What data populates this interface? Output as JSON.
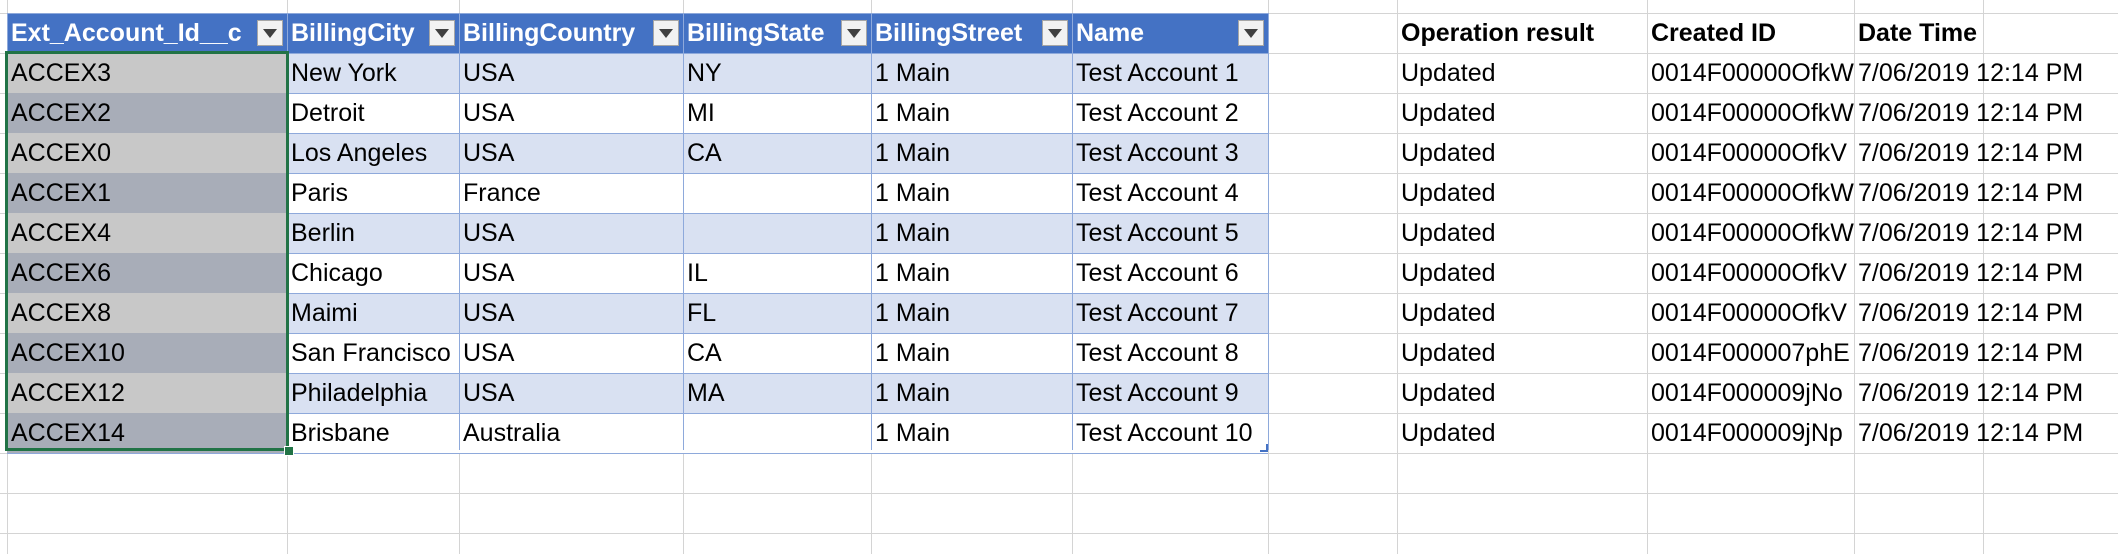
{
  "table": {
    "headers": [
      "Ext_Account_Id__c",
      "BillingCity",
      "BillingCountry",
      "BillingState",
      "BillingStreet",
      "Name"
    ],
    "rows": [
      [
        "ACCEX3",
        "New York",
        "USA",
        "NY",
        "1 Main",
        "Test Account 1"
      ],
      [
        "ACCEX2",
        "Detroit",
        "USA",
        "MI",
        "1 Main",
        "Test Account 2"
      ],
      [
        "ACCEX0",
        "Los Angeles",
        "USA",
        "CA",
        "1 Main",
        "Test Account 3"
      ],
      [
        "ACCEX1",
        "Paris",
        "France",
        "",
        "1 Main",
        "Test Account 4"
      ],
      [
        "ACCEX4",
        "Berlin",
        "USA",
        "",
        "1 Main",
        "Test Account 5"
      ],
      [
        "ACCEX6",
        "Chicago",
        "USA",
        "IL",
        "1 Main",
        "Test Account 6"
      ],
      [
        "ACCEX8",
        "Maimi",
        "USA",
        "FL",
        "1 Main",
        "Test Account 7"
      ],
      [
        "ACCEX10",
        "San Francisco",
        "USA",
        "CA",
        "1 Main",
        "Test Account 8"
      ],
      [
        "ACCEX12",
        "Philadelphia",
        "USA",
        "MA",
        "1 Main",
        "Test Account 9"
      ],
      [
        "ACCEX14",
        "Brisbane",
        "Australia",
        "",
        "1 Main",
        "Test Account 10"
      ]
    ]
  },
  "results": {
    "headers": [
      "Operation result",
      "Created ID",
      "Date Time"
    ],
    "rows": [
      [
        "Updated",
        "0014F00000OfkW",
        "7/06/2019 12:14 PM"
      ],
      [
        "Updated",
        "0014F00000OfkW",
        "7/06/2019 12:14 PM"
      ],
      [
        "Updated",
        "0014F00000OfkV",
        "7/06/2019 12:14 PM"
      ],
      [
        "Updated",
        "0014F00000OfkW",
        "7/06/2019 12:14 PM"
      ],
      [
        "Updated",
        "0014F00000OfkW",
        "7/06/2019 12:14 PM"
      ],
      [
        "Updated",
        "0014F00000OfkV",
        "7/06/2019 12:14 PM"
      ],
      [
        "Updated",
        "0014F00000OfkV",
        "7/06/2019 12:14 PM"
      ],
      [
        "Updated",
        "0014F000007phE",
        "7/06/2019 12:14 PM"
      ],
      [
        "Updated",
        "0014F000009jNo",
        "7/06/2019 12:14 PM"
      ],
      [
        "Updated",
        "0014F000009jNp",
        "7/06/2019 12:14 PM"
      ]
    ]
  },
  "colors": {
    "header_fill": "#4472c4",
    "band_fill": "#d9e1f2",
    "selection_border": "#217346",
    "id_cell_light": "#c8c8c8",
    "id_cell_dark": "#a8adb8"
  },
  "icons": {
    "filter_button": "filter-dropdown-icon"
  }
}
